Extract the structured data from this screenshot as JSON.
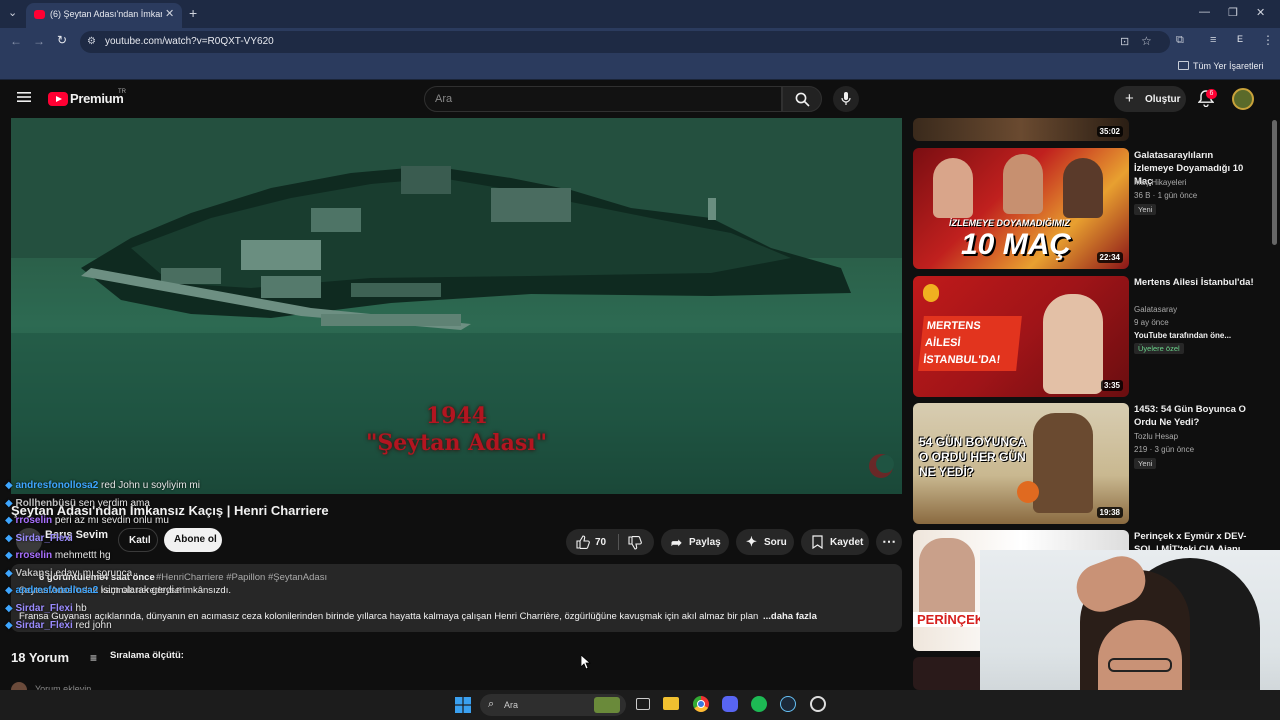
{
  "browser": {
    "tab_title": "(6) Şeytan Adası'ndan İmkansız",
    "url": "youtube.com/watch?v=R0QXT-VY620",
    "bookmarks_label": "Tüm Yer İşaretleri",
    "profile_letter": "E"
  },
  "youtube": {
    "logo_text": "Premium",
    "logo_sup": "TR",
    "search_placeholder": "Ara",
    "create_label": "Oluştur",
    "notif_count": "6"
  },
  "video": {
    "overlay_line1": "1944",
    "overlay_line2": "\"Şeytan Adası\"",
    "title": "Şeytan Adası'ndan İmkansız Kaçış | Henri Charriere",
    "channel": "Barış Sevim",
    "join_label": "Katıl",
    "subscribe_label": "Abone ol",
    "like_count": "70",
    "share_label": "Paylaş",
    "ask_label": "Soru",
    "save_label": "Kaydet",
    "views": "6 görüntüleme",
    "age": "4 saat önce",
    "tags": "#HenriCharriere #Papillon #ŞeytanAdası",
    "desc_line1": "Şeytan Adası'ndan kaçmak neredeyse imkânsızdı.",
    "desc_line2": "Fransa Guyanası açıklarında, dünyanın en acımasız ceza kolonilerinden birinde yıllarca hayatta kalmaya çalışan Henri Charrière, özgürlüğüne kavuşmak için akıl almaz bir plan yaptı.",
    "more_label": "...daha fazla",
    "comments_count": "18 Yorum",
    "sort_label": "Sıralama ölçütü:",
    "add_comment": "Yorum ekleyin..."
  },
  "chat": [
    {
      "user": "andresfonollosa2",
      "msg": "red John u soyliyim mi",
      "color": "#3ea6ff"
    },
    {
      "user": "Rollhenbüsü",
      "msg": "sen yerdim ama",
      "color": "#bfbfbf"
    },
    {
      "user": "rroselin",
      "msg": "peri az mı sevdin onlu mu",
      "color": "#a970ff"
    },
    {
      "user": "Sirdar_Flexi",
      "msg": "",
      "color": "#9b8cff"
    },
    {
      "user": "rroselin",
      "msg": "mehmettt hg",
      "color": "#a970ff"
    },
    {
      "user": "Vakansi",
      "msg": "edayı mı sorunca",
      "color": "#bfbfbf"
    },
    {
      "user": "andresfonollosa2",
      "msg": "isim olarak gerdi.m",
      "color": "#3ea6ff"
    },
    {
      "user": "Sirdar_Flexi",
      "msg": "hb",
      "color": "#9b8cff"
    },
    {
      "user": "Sirdar_Flexi",
      "msg": "red john",
      "color": "#9b8cff"
    }
  ],
  "sidebar": [
    {
      "title": "",
      "channel": "",
      "meta": "",
      "duration": "35:02",
      "badge": ""
    },
    {
      "title": "Galatasaraylıların İzlemeye Doyamadığı 10 Maç",
      "channel": "Maç Hikayeleri",
      "meta": "36 B · 1 gün önce",
      "duration": "22:34",
      "badge": "Yeni",
      "thumb_text": "10 MAÇ",
      "thumb_sub": "İZLEMEYE DOYAMADIĞIMIZ"
    },
    {
      "title": "Mertens Ailesi İstanbul'da!",
      "channel": "Galatasaray",
      "meta": "9 ay önce",
      "extra": "YouTube tarafından öne...",
      "duration": "3:35",
      "badge": "Üyelere özel",
      "thumb_text": "MERTENS AİLESİ İSTANBUL'DA!"
    },
    {
      "title": "1453: 54 Gün Boyunca O Ordu Ne Yedi?",
      "channel": "Tozlu Hesap",
      "meta": "219 · 3 gün önce",
      "duration": "19:38",
      "badge": "Yeni",
      "thumb_text": "54 GÜN BOYUNCA O ORDU HER GÜN NE YEDİ?"
    },
    {
      "title": "Perinçek x Eymür x DEV-SOL | MİT'teki CIA Ajanı",
      "channel": "",
      "meta": "",
      "duration": "",
      "badge": "",
      "thumb_text": "PERİNÇEK"
    }
  ],
  "taskbar": {
    "search_label": "Ara"
  },
  "colors": {
    "yt_red": "#ff0033",
    "chrome_dark": "#1e2a44",
    "chrome_mid": "#2b3b5e",
    "video_green": "#2a5c46",
    "accent_red": "#b31520"
  }
}
